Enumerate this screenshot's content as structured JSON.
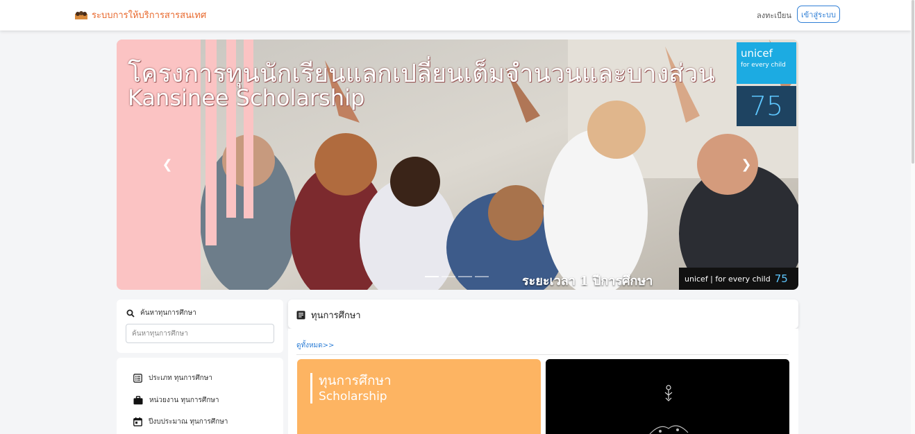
{
  "navbar": {
    "brand": "ระบบการให้บริการสารสนเทศ",
    "register": "ลงทะเบียน",
    "login": "เข้าสู่ระบบ"
  },
  "carousel": {
    "title_th": "โครงการทุนนักเรียนแลกเปลี่ยนเต็มจำนวนและบางส่วน",
    "title_en": "Kansinee Scholarship",
    "duration": "ระยะเวลา 1 ปีการศึกษา",
    "unicef_logo": "unicef",
    "unicef_tag": "for every child",
    "unicef_strip": "unicef | for every child",
    "anniversary": "75",
    "prev_icon": "chevron-left",
    "next_icon": "chevron-right",
    "slide_count": 4,
    "active_slide": 1
  },
  "search": {
    "label": "ค้นหาทุนการศึกษา",
    "placeholder": "ค้นหาทุนการศึกษา"
  },
  "menu": [
    {
      "label": "ประเภท ทุนการศึกษา",
      "icon": "list-icon"
    },
    {
      "label": "หน่วยงาน ทุนการศึกษา",
      "icon": "briefcase-icon"
    },
    {
      "label": "ปีงบประมาณ ทุนการศึกษา",
      "icon": "calendar-icon"
    }
  ],
  "main": {
    "title": "ทุนการศึกษา",
    "view_all": "ดูทั้งหมด>>",
    "card1_th": "ทุนการศึกษา",
    "card1_en": "Scholarship"
  },
  "colors": {
    "brand": "#e8682c",
    "primary": "#2f7fd6",
    "hero_pink": "#fbc3c3",
    "card_orange": "#fdb462",
    "unicef_blue": "#1cabe2"
  }
}
